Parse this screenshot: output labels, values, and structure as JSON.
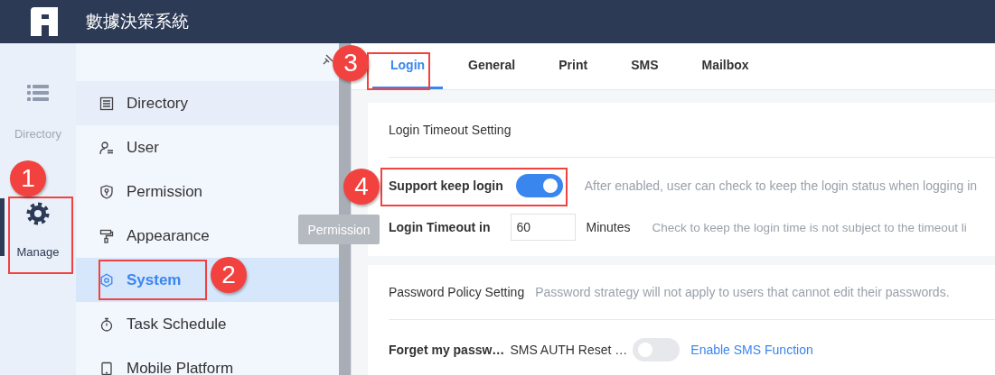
{
  "header": {
    "title": "數據決策系統"
  },
  "rail": [
    {
      "label": "Directory",
      "selected": false
    },
    {
      "label": "Manage",
      "selected": true
    }
  ],
  "menu": [
    {
      "label": "Directory",
      "selected": false
    },
    {
      "label": "User",
      "selected": false
    },
    {
      "label": "Permission",
      "selected": false
    },
    {
      "label": "Appearance",
      "selected": false
    },
    {
      "label": "System",
      "selected": true
    },
    {
      "label": "Task Schedule",
      "selected": false
    },
    {
      "label": "Mobile Platform",
      "selected": false
    }
  ],
  "tooltip": "Permission",
  "tabs": [
    {
      "label": "Login",
      "selected": true
    },
    {
      "label": "General",
      "selected": false
    },
    {
      "label": "Print",
      "selected": false
    },
    {
      "label": "SMS",
      "selected": false
    },
    {
      "label": "Mailbox",
      "selected": false
    }
  ],
  "login_timeout": {
    "title": "Login Timeout Setting",
    "keep_login": {
      "label": "Support keep login",
      "on": true,
      "hint": "After enabled, user can check to keep the login status when logging in"
    },
    "timeout": {
      "label": "Login Timeout in",
      "value": "60",
      "unit": "Minutes",
      "hint": "Check to keep the login time is not subject to the timeout li"
    }
  },
  "password_policy": {
    "title": "Password Policy Setting",
    "note": "Password strategy will not apply to users that cannot edit their passwords.",
    "forget": {
      "label": "Forget my passw…",
      "option": "SMS AUTH Reset …",
      "on": false,
      "link": "Enable SMS Function"
    }
  },
  "callouts": [
    {
      "number": "1"
    },
    {
      "number": "2"
    },
    {
      "number": "3"
    },
    {
      "number": "4"
    }
  ]
}
